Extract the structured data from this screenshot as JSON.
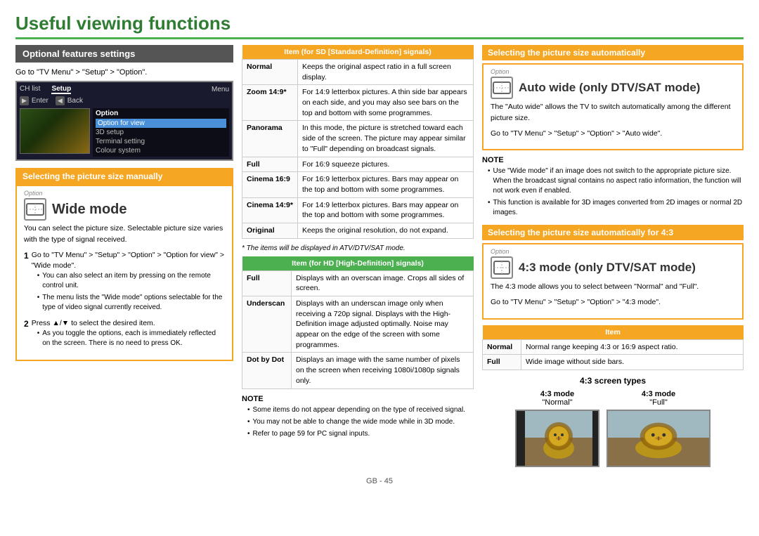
{
  "page": {
    "title": "Useful viewing functions",
    "footer": "GB - 45"
  },
  "left_col": {
    "opt_heading": "Optional features settings",
    "go_to": "Go to \"TV Menu\" > \"Setup\" > \"Option\".",
    "tv_menu": {
      "menu_label": "Menu",
      "items": [
        "CH list",
        "Setup"
      ],
      "nav_items": [
        "Enter",
        "Back"
      ],
      "option_label": "Option",
      "option_items": [
        "Option for view",
        "3D setup",
        "Terminal setting",
        "Colour system"
      ]
    },
    "select_manual_heading": "Selecting the picture size manually",
    "option_tag": "Option",
    "wide_mode_title": "Wide mode",
    "wide_mode_icon": "⬜",
    "wide_mode_body": "You can select the picture size. Selectable picture size varies with the type of signal received.",
    "steps": [
      {
        "num": "1",
        "text": "Go to \"TV Menu\" > \"Setup\" > \"Option\" > \"Option for view\" > \"Wide mode\".",
        "bullets": [
          "You can also select an item by pressing  on the remote control unit.",
          "The menu lists the \"Wide mode\" options selectable for the type of video signal currently received."
        ]
      },
      {
        "num": "2",
        "text": "Press ▲/▼ to select the desired item.",
        "bullets": [
          "As you toggle the options, each is immediately reflected on the screen. There is no need to press OK."
        ]
      }
    ]
  },
  "mid_col": {
    "sd_table_heading": "Item (for SD [Standard-Definition] signals)",
    "sd_rows": [
      {
        "label": "Normal",
        "desc": "Keeps the original aspect ratio in a full screen display."
      },
      {
        "label": "Zoom 14:9*",
        "desc": "For 14:9 letterbox pictures. A thin side bar appears on each side, and you may also see bars on the top and bottom with some programmes."
      },
      {
        "label": "Panorama",
        "desc": "In this mode, the picture is stretched toward each side of the screen. The picture may appear similar to \"Full\" depending on broadcast signals."
      },
      {
        "label": "Full",
        "desc": "For 16:9 squeeze pictures."
      },
      {
        "label": "Cinema 16:9",
        "desc": "For 16:9 letterbox pictures. Bars may appear on the top and bottom with some programmes."
      },
      {
        "label": "Cinema 14:9*",
        "desc": "For 14:9 letterbox pictures. Bars may appear on the top and bottom with some programmes."
      },
      {
        "label": "Original",
        "desc": "Keeps the original resolution, do not expand."
      }
    ],
    "asterisk_note": "* The items will be displayed in ATV/DTV/SAT mode.",
    "hd_table_heading": "Item (for HD [High-Definition] signals)",
    "hd_rows": [
      {
        "label": "Full",
        "desc": "Displays with an overscan image. Crops all sides of screen."
      },
      {
        "label": "Underscan",
        "desc": "Displays with an underscan image only when receiving a 720p signal. Displays with the High-Definition image adjusted optimally. Noise may appear on the edge of the screen with some programmes."
      },
      {
        "label": "Dot by Dot",
        "desc": "Displays an image with the same number of pixels on the screen when receiving 1080i/1080p signals only."
      }
    ],
    "note_title": "NOTE",
    "note_bullets": [
      "Some items do not appear depending on the type of received signal.",
      "You may not be able to change the wide mode while in 3D mode.",
      "Refer to page 59 for PC signal inputs."
    ]
  },
  "right_col": {
    "auto_wide_heading": "Selecting the picture size automatically",
    "option_tag": "Option",
    "auto_wide_title": "Auto wide (only DTV/SAT mode)",
    "auto_wide_icon": "⬜",
    "auto_wide_body1": "The \"Auto wide\" allows the TV to switch automatically among the different picture size.",
    "auto_wide_body2": "Go to \"TV Menu\" > \"Setup\" > \"Option\" > \"Auto wide\".",
    "note_title": "NOTE",
    "note_bullets": [
      "Use \"Wide mode\" if an image does not switch to the appropriate picture size. When the broadcast signal contains no aspect ratio information, the function will not work even if enabled.",
      "This function is available for 3D images converted from 2D images or normal 2D images."
    ],
    "four3_heading": "Selecting the picture size automatically for 4:3",
    "four3_option_tag": "Option",
    "four3_title": "4:3 mode (only DTV/SAT mode)",
    "four3_icon": "⬜",
    "four3_body1": "The 4:3 mode allows you to select between \"Normal\" and \"Full\".",
    "four3_body2": "Go to \"TV Menu\" > \"Setup\" > \"Option\" > \"4:3 mode\".",
    "four3_table_heading": "Item",
    "four3_rows": [
      {
        "label": "Normal",
        "desc": "Normal range keeping 4:3 or 16:9 aspect ratio."
      },
      {
        "label": "Full",
        "desc": "Wide image without side bars."
      }
    ],
    "screen_types_heading": "4:3 screen types",
    "screen_type_left_top": "4:3 mode",
    "screen_type_left_bottom": "\"Normal\"",
    "screen_type_right_top": "4:3 mode",
    "screen_type_right_bottom": "\"Full\""
  }
}
